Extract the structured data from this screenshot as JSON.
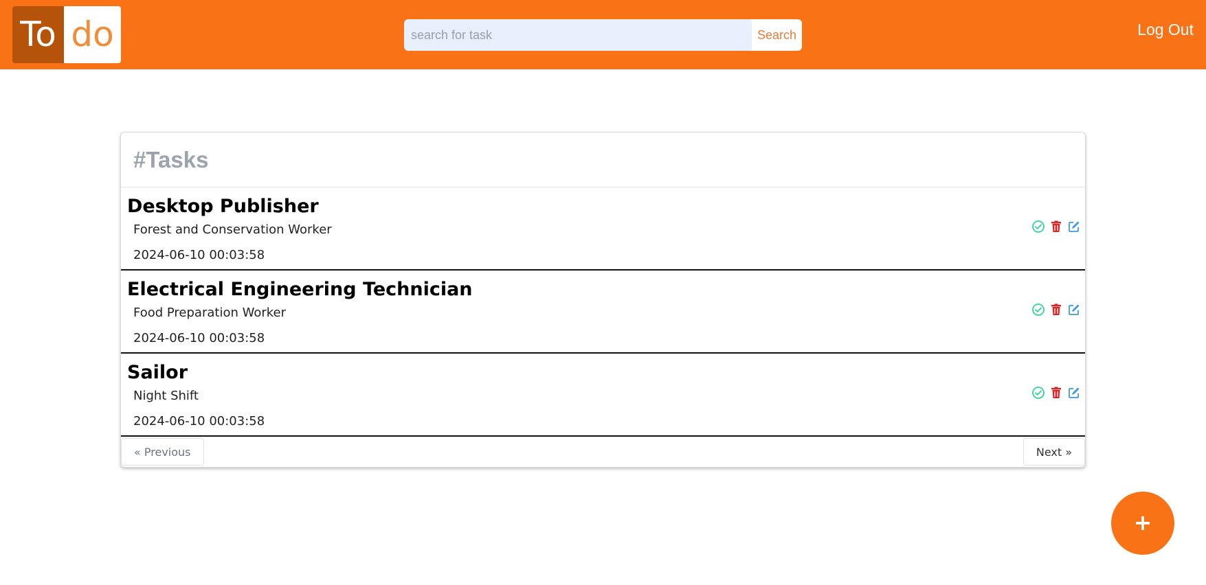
{
  "header": {
    "logo_left": "To",
    "logo_right": "do",
    "search_placeholder": "search for task",
    "search_value": "",
    "search_button": "Search",
    "logout": "Log Out"
  },
  "tasks_card": {
    "title": "#Tasks",
    "items": [
      {
        "title": "Desktop Publisher",
        "description": "Forest and Conservation Worker",
        "date": "2024-06-10 00:03:58"
      },
      {
        "title": "Electrical Engineering Technician",
        "description": "Food Preparation Worker",
        "date": "2024-06-10 00:03:58"
      },
      {
        "title": "Sailor",
        "description": "Night Shift",
        "date": "2024-06-10 00:03:58"
      }
    ],
    "actions": {
      "complete_icon": "check-circle-icon",
      "delete_icon": "trash-icon",
      "edit_icon": "edit-icon"
    },
    "pagination": {
      "previous": "« Previous",
      "next": "Next »"
    }
  },
  "fab": {
    "label": "+",
    "icon": "plus-icon"
  },
  "colors": {
    "brand": "#f97316",
    "logo_dark": "#b45309",
    "complete": "#34d399",
    "delete": "#dc2626",
    "edit": "#3b9ae1"
  }
}
